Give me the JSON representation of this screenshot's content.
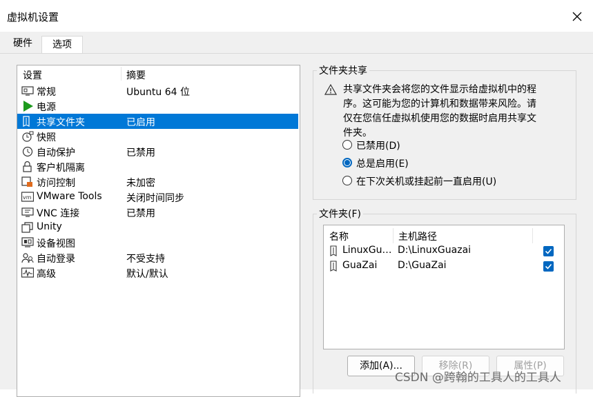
{
  "window": {
    "title": "虚拟机设置"
  },
  "tabs": [
    {
      "label": "硬件",
      "active": false
    },
    {
      "label": "选项",
      "active": true
    }
  ],
  "settings_list": {
    "columns": [
      "设置",
      "摘要"
    ],
    "items": [
      {
        "name": "常规",
        "value": "Ubuntu 64 位",
        "icon": "monitor-icon"
      },
      {
        "name": "电源",
        "value": "",
        "icon": "play-icon"
      },
      {
        "name": "共享文件夹",
        "value": "已启用",
        "icon": "shared-folder-icon",
        "selected": true
      },
      {
        "name": "快照",
        "value": "",
        "icon": "snapshot-icon"
      },
      {
        "name": "自动保护",
        "value": "已禁用",
        "icon": "clock-icon"
      },
      {
        "name": "客户机隔离",
        "value": "",
        "icon": "lock-icon"
      },
      {
        "name": "访问控制",
        "value": "未加密",
        "icon": "access-control-icon"
      },
      {
        "name": "VMware Tools",
        "value": "关闭时间同步",
        "icon": "vm-icon"
      },
      {
        "name": "VNC 连接",
        "value": "已禁用",
        "icon": "vnc-icon"
      },
      {
        "name": "Unity",
        "value": "",
        "icon": "unity-icon"
      },
      {
        "name": "设备视图",
        "value": "",
        "icon": "device-view-icon"
      },
      {
        "name": "自动登录",
        "value": "不受支持",
        "icon": "users-icon"
      },
      {
        "name": "高级",
        "value": "默认/默认",
        "icon": "graph-icon"
      }
    ]
  },
  "folder_sharing": {
    "group_title": "文件夹共享",
    "warning": "共享文件夹会将您的文件显示给虚拟机中的程序。这可能为您的计算机和数据带来风险。请仅在您信任虚拟机使用您的数据时启用共享文件夹。",
    "options": [
      {
        "label": "已禁用(D)",
        "checked": false
      },
      {
        "label": "总是启用(E)",
        "checked": true
      },
      {
        "label": "在下次关机或挂起前一直启用(U)",
        "checked": false
      }
    ]
  },
  "folders": {
    "group_title": "文件夹(F)",
    "columns": [
      "名称",
      "主机路径"
    ],
    "rows": [
      {
        "name": "LinuxGuazai",
        "path": "D:\\LinuxGuazai",
        "enabled": true
      },
      {
        "name": "GuaZai",
        "path": "D:\\GuaZai",
        "enabled": true
      }
    ],
    "buttons": {
      "add": "添加(A)...",
      "remove": "移除(R)",
      "properties": "属性(P)"
    }
  },
  "watermark": "CSDN @跨翰的工具人的工具人",
  "colors": {
    "selection": "#0078d7",
    "accent": "#0067c0",
    "dialog_bg": "#f0f0f0"
  }
}
